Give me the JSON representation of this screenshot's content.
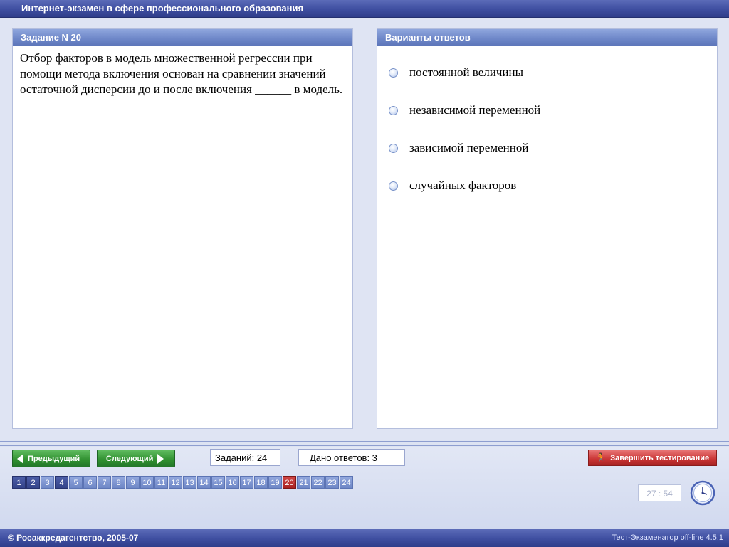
{
  "app": {
    "title": "Интернет-экзамен в сфере профессионального образования"
  },
  "question": {
    "header": "Задание N 20",
    "text": "Отбор факторов в модель множественной регрессии при помощи метода включения основан на сравнении значений остаточной дисперсии до и после включения ______ в модель."
  },
  "answers": {
    "header": "Варианты ответов",
    "options": [
      "постоянной величины",
      "независимой переменной",
      "зависимой переменной",
      "случайных факторов"
    ]
  },
  "nav": {
    "prev_label": "Предыдущий",
    "next_label": "Следующий",
    "tasks_label": "Заданий: 24",
    "answered_label": "Дано ответов: 3",
    "finish_label": "Завершить тестирование"
  },
  "question_numbers": {
    "items": [
      "1",
      "2",
      "3",
      "4",
      "5",
      "6",
      "7",
      "8",
      "9",
      "10",
      "11",
      "12",
      "13",
      "14",
      "15",
      "16",
      "17",
      "18",
      "19",
      "20",
      "21",
      "22",
      "23",
      "24"
    ],
    "answered": [
      "1",
      "2",
      "4"
    ],
    "current": "20"
  },
  "timer": {
    "value": "27 : 54"
  },
  "footer": {
    "copyright": "© Росаккредагентство, 2005-07",
    "version": "Тест-Экзаменатор off-line 4.5.1"
  },
  "colors": {
    "header_blue": "#3e4ea0",
    "panel_header": "#6d86c8",
    "nav_green": "#2f8f2f",
    "finish_red": "#c93434",
    "current_red": "#a82222",
    "answered_blue": "#34448a"
  },
  "icons": {
    "prev": "arrow-left-icon",
    "next": "arrow-right-icon",
    "finish": "running-person-icon",
    "timer": "clock-icon",
    "option": "radio-icon"
  }
}
